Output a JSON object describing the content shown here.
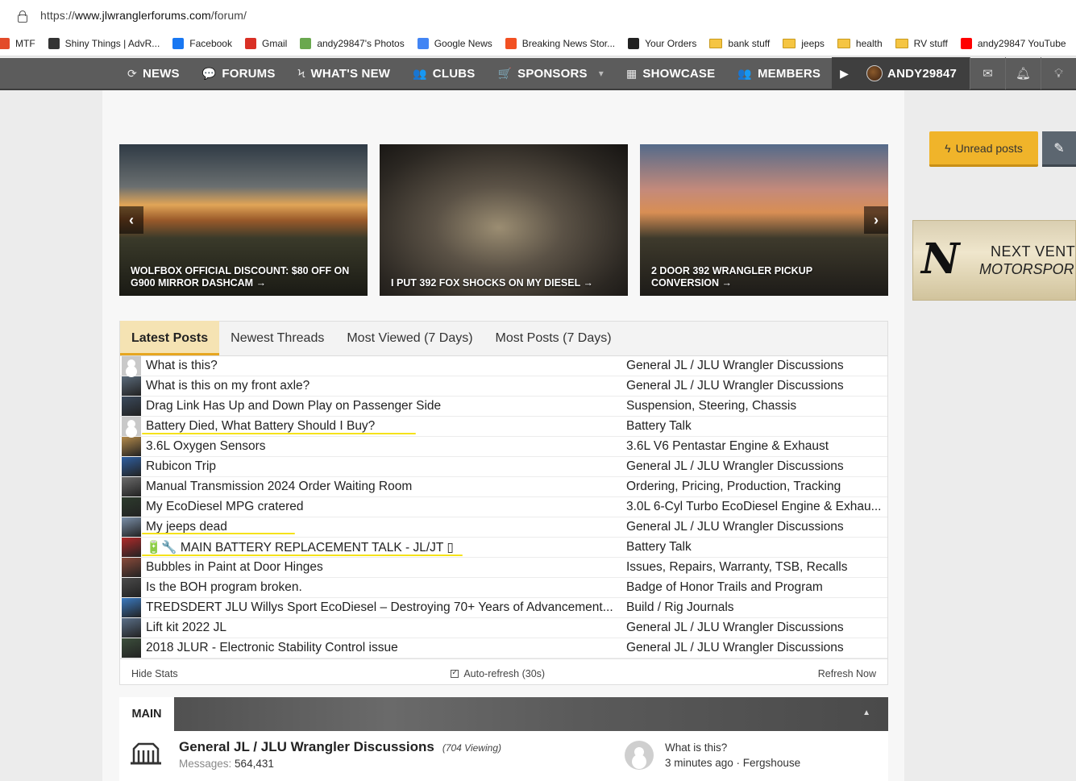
{
  "browser": {
    "url_prefix": "https://",
    "url_host": "www.jlwranglerforums.com",
    "url_path": "/forum/"
  },
  "bookmarks": [
    {
      "label": "MTF",
      "icon": "mtf-icon",
      "color": "#e34b2a"
    },
    {
      "label": "Shiny Things | AdvR...",
      "icon": "advrider-icon",
      "color": "#333333"
    },
    {
      "label": "Facebook",
      "icon": "facebook-icon",
      "color": "#1877f2"
    },
    {
      "label": "Gmail",
      "icon": "gmail-icon",
      "color": "#d93025"
    },
    {
      "label": "andy29847's Photos",
      "icon": "photos-icon",
      "color": "#6aa84f"
    },
    {
      "label": "Google News",
      "icon": "google-news-icon",
      "color": "#4285f4"
    },
    {
      "label": "Breaking News Stor...",
      "icon": "msn-icon",
      "color": "#f25022"
    },
    {
      "label": "Your Orders",
      "icon": "amazon-icon",
      "color": "#222222"
    },
    {
      "label": "bank stuff",
      "icon": "folder-icon",
      "color": "#f5c542"
    },
    {
      "label": "jeeps",
      "icon": "folder-icon",
      "color": "#f5c542"
    },
    {
      "label": "health",
      "icon": "folder-icon",
      "color": "#f5c542"
    },
    {
      "label": "RV stuff",
      "icon": "folder-icon",
      "color": "#f5c542"
    },
    {
      "label": "andy29847 YouTube",
      "icon": "youtube-icon",
      "color": "#ff0000"
    }
  ],
  "nav": {
    "items": [
      {
        "label": "NEWS",
        "icon": "⟳"
      },
      {
        "label": "FORUMS",
        "icon": "💬"
      },
      {
        "label": "WHAT'S NEW",
        "icon": "ϟ"
      },
      {
        "label": "CLUBS",
        "icon": "👥"
      },
      {
        "label": "SPONSORS",
        "icon": "🛒"
      },
      {
        "label": "SHOWCASE",
        "icon": "▦"
      },
      {
        "label": "MEMBERS",
        "icon": "👥"
      }
    ],
    "sponsors_caret": "▾",
    "username": "ANDY29847"
  },
  "slides": [
    {
      "caption": "WOLFBOX OFFICIAL DISCOUNT: $80 OFF ON G900 MIRROR DASHCAM →"
    },
    {
      "caption": "I PUT 392 FOX SHOCKS ON MY DIESEL →"
    },
    {
      "caption": "2 DOOR 392 WRANGLER PICKUP CONVERSION →"
    }
  ],
  "slider": {
    "prev": "‹",
    "next": "›"
  },
  "tabs": [
    {
      "label": "Latest Posts",
      "active": true
    },
    {
      "label": "Newest Threads",
      "active": false
    },
    {
      "label": "Most Viewed (7 Days)",
      "active": false
    },
    {
      "label": "Most Posts (7 Days)",
      "active": false
    }
  ],
  "posts": [
    {
      "title": "What is this?",
      "forum": "General JL / JLU Wrangler Discussions",
      "avatar": "default",
      "color": "#c9c9c9"
    },
    {
      "title": "What is this on my front axle?",
      "forum": "General JL / JLU Wrangler Discussions",
      "avatar": "photo",
      "color": "#5a6a7a"
    },
    {
      "title": "Drag Link Has Up and Down Play on Passenger Side",
      "forum": "Suspension, Steering, Chassis",
      "avatar": "photo",
      "color": "#3b4a5c"
    },
    {
      "title": "Battery Died, What Battery Should I Buy?",
      "forum": "Battery Talk",
      "avatar": "default",
      "color": "#c9c9c9"
    },
    {
      "title": "3.6L Oxygen Sensors",
      "forum": "3.6L V6 Pentastar Engine & Exhaust",
      "avatar": "photo",
      "color": "#b38a4a"
    },
    {
      "title": "Rubicon Trip",
      "forum": "General JL / JLU Wrangler Discussions",
      "avatar": "photo",
      "color": "#2f5fa0"
    },
    {
      "title": "Manual Transmission 2024 Order Waiting Room",
      "forum": "Ordering, Pricing, Production, Tracking",
      "avatar": "photo",
      "color": "#6b6b6b"
    },
    {
      "title": "My EcoDiesel MPG cratered",
      "forum": "3.0L 6-Cyl Turbo EcoDiesel Engine & Exhau...",
      "avatar": "photo",
      "color": "#2d3b2d"
    },
    {
      "title": "My jeeps dead",
      "forum": "General JL / JLU Wrangler Discussions",
      "avatar": "photo",
      "color": "#7a8fa8"
    },
    {
      "title": "🔋🔧 MAIN BATTERY REPLACEMENT TALK - JL/JT ▯",
      "forum": "Battery Talk",
      "avatar": "photo",
      "color": "#b02a2a"
    },
    {
      "title": "Bubbles in Paint at Door Hinges",
      "forum": "Issues, Repairs, Warranty, TSB, Recalls",
      "avatar": "photo",
      "color": "#8a4a3a"
    },
    {
      "title": "Is the BOH program broken.",
      "forum": "Badge of Honor Trails and Program",
      "avatar": "photo",
      "color": "#4a4a4a"
    },
    {
      "title": "TREDSDERT JLU Willys Sport EcoDiesel – Destroying 70+ Years of Advancement...",
      "forum": "Build / Rig Journals",
      "avatar": "photo",
      "color": "#3a7ac0"
    },
    {
      "title": "Lift kit 2022 JL",
      "forum": "General JL / JLU Wrangler Discussions",
      "avatar": "photo",
      "color": "#5a6f88"
    },
    {
      "title": "2018 JLUR - Electronic Stability Control issue",
      "forum": "General JL / JLU Wrangler Discussions",
      "avatar": "photo",
      "color": "#3c4f3c"
    }
  ],
  "panel_footer": {
    "hide_stats": "Hide Stats",
    "auto_refresh": "Auto-refresh (30s)",
    "refresh_now": "Refresh Now"
  },
  "main_section": {
    "label": "MAIN",
    "collapse": "▲",
    "forum_name": "General JL / JLU Wrangler Discussions",
    "viewing": "(704 Viewing)",
    "messages_label": "Messages:",
    "messages_count": "564,431",
    "last_post_title": "What is this?",
    "last_post_meta": "3 minutes ago · Fergshouse"
  },
  "sidebar": {
    "unread_label": "Unread posts",
    "ad_logo": "N",
    "ad_line1": "NEXT VENTU",
    "ad_line2": "MOTORSPORT"
  }
}
